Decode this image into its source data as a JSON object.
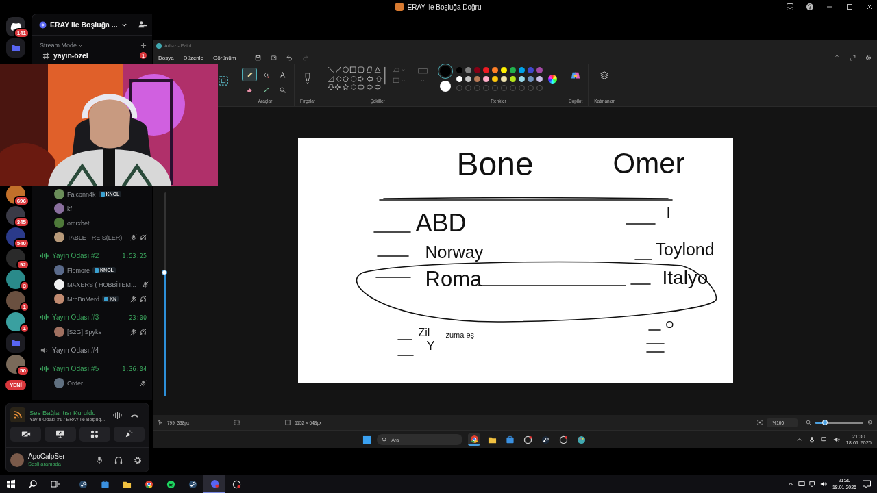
{
  "window": {
    "title": "ERAY ile Boşluğa Doğru"
  },
  "server_rail": [
    {
      "kind": "home",
      "badge": "141"
    },
    {
      "kind": "folder"
    },
    {
      "kind": "server",
      "badge": "696"
    },
    {
      "kind": "server",
      "badge": "345"
    },
    {
      "kind": "server",
      "badge": "540"
    },
    {
      "kind": "server",
      "badge": "92"
    },
    {
      "kind": "server",
      "badge": "3"
    },
    {
      "kind": "server",
      "badge": "1"
    },
    {
      "kind": "server",
      "badge": "1"
    },
    {
      "kind": "folder"
    },
    {
      "kind": "server",
      "badge": "50"
    }
  ],
  "new_badge": "YENİ",
  "server": {
    "name": "ERAY ile Boşluğa ..."
  },
  "section": {
    "label": "Stream Mode"
  },
  "text_channel": {
    "name": "yayın-özel",
    "unread": "1"
  },
  "channel_list": [
    {
      "kind": "user",
      "name": "Falconn4k",
      "tag": "KNGL",
      "muted": false,
      "deafened": false
    },
    {
      "kind": "user",
      "name": "kf",
      "muted": false,
      "deafened": false
    },
    {
      "kind": "user",
      "name": "omrxbet",
      "muted": false,
      "deafened": false
    },
    {
      "kind": "user",
      "name": "TABLET REIS(LER)",
      "muted": true,
      "deafened": true
    },
    {
      "kind": "voice",
      "name": "Yayın Odası #2",
      "time": "1:53:25",
      "live": true
    },
    {
      "kind": "user",
      "name": "Flomore",
      "tag": "KNGL",
      "muted": false,
      "deafened": false
    },
    {
      "kind": "user",
      "name": "MAXERS ( HOBBİTEM...",
      "muted": true,
      "deafened": false
    },
    {
      "kind": "user",
      "name": "MrbBnMerd",
      "tag": "KN",
      "muted": true,
      "deafened": true
    },
    {
      "kind": "voice",
      "name": "Yayın Odası #3",
      "time": "23:00",
      "live": true
    },
    {
      "kind": "user",
      "name": "[S2G] Spyks",
      "muted": true,
      "deafened": true
    },
    {
      "kind": "voice",
      "name": "Yayın Odası #4",
      "live": false
    },
    {
      "kind": "voice",
      "name": "Yayın Odası #5",
      "time": "1:36:04",
      "live": true
    },
    {
      "kind": "user",
      "name": "Order",
      "muted": true,
      "deafened": false
    }
  ],
  "voice_panel": {
    "status": "Ses Bağlantısı Kuruldu",
    "channel": "Yayın Odası #1 / ERAY ile Boşluğ..."
  },
  "user_panel": {
    "name": "ApoCalpSer",
    "status": "Sesli aramada"
  },
  "paint": {
    "title": "Adsız - Paint",
    "menu": [
      "Dosya",
      "Düzenle",
      "Görünüm"
    ],
    "undo": {
      "disabled": false
    },
    "redo": {
      "disabled": true
    },
    "tools": [
      {
        "kind": "pencil",
        "selected": true
      },
      {
        "kind": "fill",
        "selected": false
      },
      {
        "kind": "text",
        "selected": false
      },
      {
        "kind": "eraser",
        "selected": false
      },
      {
        "kind": "picker",
        "selected": false
      },
      {
        "kind": "magnifier",
        "selected": false
      }
    ],
    "groups": {
      "tools": "Araçlar",
      "brushes": "Fırçalar",
      "shapes": "Şekiller",
      "colors": "Renkler",
      "copilot": "Copilot",
      "layers": "Katmanlar"
    },
    "current_colors": [
      {
        "color": "#000000",
        "selected": true
      },
      {
        "color": "#ffffff",
        "selected": false
      }
    ],
    "palette": [
      {
        "color": "#000000"
      },
      {
        "color": "#7f7f7f"
      },
      {
        "color": "#880015"
      },
      {
        "color": "#ed1c24"
      },
      {
        "color": "#ff7f27"
      },
      {
        "color": "#fff200"
      },
      {
        "color": "#22b14c"
      },
      {
        "color": "#00a2e8"
      },
      {
        "color": "#3f48cc"
      },
      {
        "color": "#a349a4"
      },
      {
        "color": "#ffffff"
      },
      {
        "color": "#c3c3c3"
      },
      {
        "color": "#b97a57"
      },
      {
        "color": "#ffaec9"
      },
      {
        "color": "#ffc90e"
      },
      {
        "color": "#efe4b0"
      },
      {
        "color": "#b5e61d"
      },
      {
        "color": "#99d9ea"
      },
      {
        "color": "#7092be"
      },
      {
        "color": "#c8bfe7"
      }
    ],
    "size_slider": {
      "level": 0.61
    },
    "canvas_words": [
      "Bone",
      "Omer",
      "ABD",
      "I",
      "Norway",
      "Toylond",
      "Roma",
      "Italyo",
      "O",
      "Zil",
      "zuma eş",
      "Y"
    ],
    "status": {
      "cursor": "799, 338px",
      "size": "1152 × 648px",
      "zoom": "%100",
      "zoom_slider": {
        "level": 0.2
      }
    }
  },
  "inner_taskbar": {
    "search": "Ara",
    "apps": [
      {
        "kind": "chrome",
        "selected": true
      },
      {
        "kind": "explorer",
        "selected": false
      },
      {
        "kind": "store",
        "selected": false
      },
      {
        "kind": "app",
        "selected": false
      },
      {
        "kind": "steam",
        "selected": false
      },
      {
        "kind": "app",
        "selected": false
      },
      {
        "kind": "paint",
        "selected": false
      }
    ],
    "time": "21:30",
    "date": "18.01.2026"
  },
  "taskbar": {
    "apps": [
      {
        "kind": "steam",
        "selected": false
      },
      {
        "kind": "store",
        "selected": false
      },
      {
        "kind": "explorer",
        "selected": false
      },
      {
        "kind": "chrome",
        "selected": false
      },
      {
        "kind": "spotify",
        "selected": false
      },
      {
        "kind": "steam",
        "selected": false
      },
      {
        "kind": "discord",
        "selected": true
      },
      {
        "kind": "app",
        "selected": false
      }
    ],
    "time": "21:30",
    "date": "18.01.2026"
  }
}
